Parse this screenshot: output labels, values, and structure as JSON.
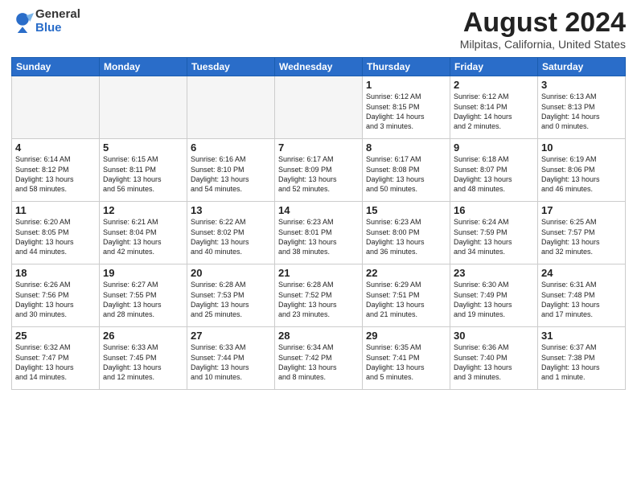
{
  "header": {
    "logo_general": "General",
    "logo_blue": "Blue",
    "month_title": "August 2024",
    "location": "Milpitas, California, United States"
  },
  "days_of_week": [
    "Sunday",
    "Monday",
    "Tuesday",
    "Wednesday",
    "Thursday",
    "Friday",
    "Saturday"
  ],
  "weeks": [
    [
      {
        "date": "",
        "info": ""
      },
      {
        "date": "",
        "info": ""
      },
      {
        "date": "",
        "info": ""
      },
      {
        "date": "",
        "info": ""
      },
      {
        "date": "1",
        "info": "Sunrise: 6:12 AM\nSunset: 8:15 PM\nDaylight: 14 hours\nand 3 minutes."
      },
      {
        "date": "2",
        "info": "Sunrise: 6:12 AM\nSunset: 8:14 PM\nDaylight: 14 hours\nand 2 minutes."
      },
      {
        "date": "3",
        "info": "Sunrise: 6:13 AM\nSunset: 8:13 PM\nDaylight: 14 hours\nand 0 minutes."
      }
    ],
    [
      {
        "date": "4",
        "info": "Sunrise: 6:14 AM\nSunset: 8:12 PM\nDaylight: 13 hours\nand 58 minutes."
      },
      {
        "date": "5",
        "info": "Sunrise: 6:15 AM\nSunset: 8:11 PM\nDaylight: 13 hours\nand 56 minutes."
      },
      {
        "date": "6",
        "info": "Sunrise: 6:16 AM\nSunset: 8:10 PM\nDaylight: 13 hours\nand 54 minutes."
      },
      {
        "date": "7",
        "info": "Sunrise: 6:17 AM\nSunset: 8:09 PM\nDaylight: 13 hours\nand 52 minutes."
      },
      {
        "date": "8",
        "info": "Sunrise: 6:17 AM\nSunset: 8:08 PM\nDaylight: 13 hours\nand 50 minutes."
      },
      {
        "date": "9",
        "info": "Sunrise: 6:18 AM\nSunset: 8:07 PM\nDaylight: 13 hours\nand 48 minutes."
      },
      {
        "date": "10",
        "info": "Sunrise: 6:19 AM\nSunset: 8:06 PM\nDaylight: 13 hours\nand 46 minutes."
      }
    ],
    [
      {
        "date": "11",
        "info": "Sunrise: 6:20 AM\nSunset: 8:05 PM\nDaylight: 13 hours\nand 44 minutes."
      },
      {
        "date": "12",
        "info": "Sunrise: 6:21 AM\nSunset: 8:04 PM\nDaylight: 13 hours\nand 42 minutes."
      },
      {
        "date": "13",
        "info": "Sunrise: 6:22 AM\nSunset: 8:02 PM\nDaylight: 13 hours\nand 40 minutes."
      },
      {
        "date": "14",
        "info": "Sunrise: 6:23 AM\nSunset: 8:01 PM\nDaylight: 13 hours\nand 38 minutes."
      },
      {
        "date": "15",
        "info": "Sunrise: 6:23 AM\nSunset: 8:00 PM\nDaylight: 13 hours\nand 36 minutes."
      },
      {
        "date": "16",
        "info": "Sunrise: 6:24 AM\nSunset: 7:59 PM\nDaylight: 13 hours\nand 34 minutes."
      },
      {
        "date": "17",
        "info": "Sunrise: 6:25 AM\nSunset: 7:57 PM\nDaylight: 13 hours\nand 32 minutes."
      }
    ],
    [
      {
        "date": "18",
        "info": "Sunrise: 6:26 AM\nSunset: 7:56 PM\nDaylight: 13 hours\nand 30 minutes."
      },
      {
        "date": "19",
        "info": "Sunrise: 6:27 AM\nSunset: 7:55 PM\nDaylight: 13 hours\nand 28 minutes."
      },
      {
        "date": "20",
        "info": "Sunrise: 6:28 AM\nSunset: 7:53 PM\nDaylight: 13 hours\nand 25 minutes."
      },
      {
        "date": "21",
        "info": "Sunrise: 6:28 AM\nSunset: 7:52 PM\nDaylight: 13 hours\nand 23 minutes."
      },
      {
        "date": "22",
        "info": "Sunrise: 6:29 AM\nSunset: 7:51 PM\nDaylight: 13 hours\nand 21 minutes."
      },
      {
        "date": "23",
        "info": "Sunrise: 6:30 AM\nSunset: 7:49 PM\nDaylight: 13 hours\nand 19 minutes."
      },
      {
        "date": "24",
        "info": "Sunrise: 6:31 AM\nSunset: 7:48 PM\nDaylight: 13 hours\nand 17 minutes."
      }
    ],
    [
      {
        "date": "25",
        "info": "Sunrise: 6:32 AM\nSunset: 7:47 PM\nDaylight: 13 hours\nand 14 minutes."
      },
      {
        "date": "26",
        "info": "Sunrise: 6:33 AM\nSunset: 7:45 PM\nDaylight: 13 hours\nand 12 minutes."
      },
      {
        "date": "27",
        "info": "Sunrise: 6:33 AM\nSunset: 7:44 PM\nDaylight: 13 hours\nand 10 minutes."
      },
      {
        "date": "28",
        "info": "Sunrise: 6:34 AM\nSunset: 7:42 PM\nDaylight: 13 hours\nand 8 minutes."
      },
      {
        "date": "29",
        "info": "Sunrise: 6:35 AM\nSunset: 7:41 PM\nDaylight: 13 hours\nand 5 minutes."
      },
      {
        "date": "30",
        "info": "Sunrise: 6:36 AM\nSunset: 7:40 PM\nDaylight: 13 hours\nand 3 minutes."
      },
      {
        "date": "31",
        "info": "Sunrise: 6:37 AM\nSunset: 7:38 PM\nDaylight: 13 hours\nand 1 minute."
      }
    ]
  ]
}
